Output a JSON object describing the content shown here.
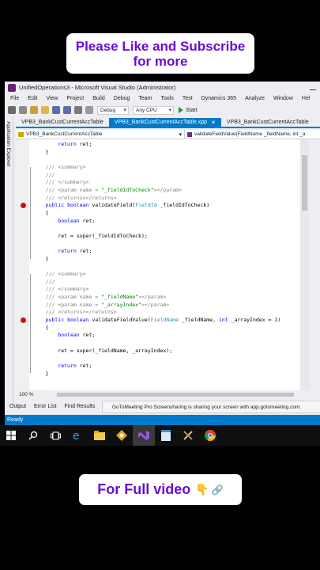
{
  "top_banner": {
    "line1": "Please Like and Subscribe",
    "line2": "for more"
  },
  "bottom_banner": {
    "text": "For Full video",
    "emoji": "👇",
    "link_icon": "🔗"
  },
  "window": {
    "title": "UnifiedOperations3 - Microsoft Visual Studio (Administrator)"
  },
  "menu": [
    "File",
    "Edit",
    "View",
    "Project",
    "Build",
    "Debug",
    "Team",
    "Tools",
    "Test",
    "Dynamics 365",
    "Analyze",
    "Window",
    "Hel"
  ],
  "toolbar": {
    "config": "Debug",
    "platform": "Any CPU",
    "start": "Start"
  },
  "sidebar": {
    "label": "Application Explorer"
  },
  "tabs": [
    {
      "label": "VPB3_BankCustCurrentAccTable",
      "active": false
    },
    {
      "label": "VPB3_BankCustCurrentAccTable.xpp",
      "active": true
    },
    {
      "label": "VPB3_BankCustCurrentAccTable",
      "active": false
    }
  ],
  "nav": {
    "left": "VPB3_BankCustCurrentAccTable",
    "right": "validateFieldValue(FieldName _fieldName, int _a"
  },
  "code": {
    "lines": [
      "        return ret;",
      "    }",
      "",
      "    /// <summary>",
      "    ///",
      "    /// </summary>",
      "    /// <param name = \"_fieldIdToCheck\"></param>",
      "    /// <returns></returns>",
      "    public boolean validateField(FieldId _fieldIdToCheck)",
      "    {",
      "        boolean ret;",
      "",
      "        ret = super(_fieldIdToCheck);",
      "",
      "        return ret;",
      "    }",
      "",
      "    /// <summary>",
      "    ///",
      "    /// </summary>",
      "    /// <param name = \"_fieldName\"></param>",
      "    /// <param name = \"_arrayIndex\"></param>",
      "    /// <returns></returns>",
      "    public boolean validateFieldValue(FieldName _fieldName, int _arrayIndex = 1)",
      "    {",
      "        boolean ret;",
      "",
      "        ret = super(_fieldName, _arrayIndex);",
      "",
      "        return ret;",
      "    }",
      "",
      "",
      "}"
    ],
    "breakpoints": [
      8,
      23
    ],
    "colors": {
      "keyword": "#0000ff",
      "comment": "#008000",
      "doc": "#808080",
      "type": "#2b91af",
      "text": "#000000",
      "string": "#a31515"
    }
  },
  "zoom": "100 %",
  "bottom_tabs": [
    "Output",
    "Error List",
    "Find Results"
  ],
  "notification": "GoToMeeting Pro Screensharing is sharing your screen with app.gotomeeting.com.",
  "status": "Ready",
  "taskbar": [
    "windows-start-icon",
    "search-icon",
    "task-view-icon",
    "edge-icon",
    "file-explorer-icon",
    "puzzle-app-icon",
    "visual-studio-icon",
    "notepad-icon",
    "tools-icon",
    "chrome-icon"
  ]
}
